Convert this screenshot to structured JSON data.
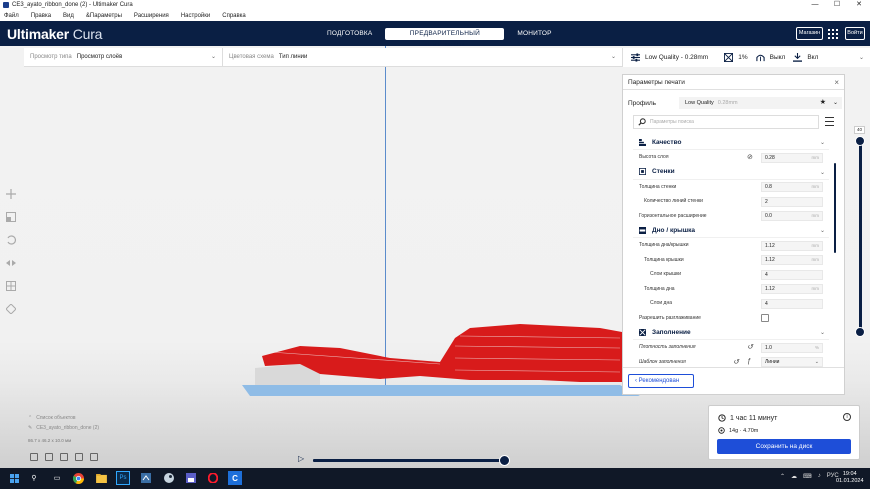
{
  "window": {
    "title": "CE3_ayato_ribbon_done (2) - Ultimaker Cura",
    "min": "—",
    "max": "☐",
    "close": "✕"
  },
  "menu": [
    "Файл",
    "Правка",
    "Вид",
    "&Параметры",
    "Расширения",
    "Настройки",
    "Справка"
  ],
  "header": {
    "logo_bold": "Ultimaker",
    "logo_light": " Cura",
    "stages": [
      "ПОДГОТОВКА",
      "ПРЕДВАРИТЕЛЬНЫЙ ПРОСМОТР",
      "МОНИТОР"
    ],
    "active_stage": 1,
    "marketplace": "Магазин",
    "login": "Войти"
  },
  "viewbar": {
    "view_type_label": "Просмотр типа",
    "view_type_value": "Просмотр слоёв",
    "color_scheme_label": "Цветовая схема",
    "color_scheme_value": "Тип линии"
  },
  "print_summary": {
    "profile": "Low Quality - 0.28mm",
    "infill": "1%",
    "support": "Выкл",
    "adhesion": "Вкл"
  },
  "panel": {
    "title": "Параметры печати",
    "profile_label": "Профиль",
    "profile_value": "Low Quality",
    "profile_dim": "0.28mm",
    "search_placeholder": "Параметры поиска",
    "recommended": "Рекомендован"
  },
  "settings": {
    "quality": {
      "title": "Качество",
      "layer_height": {
        "label": "Высота слоя",
        "value": "0.28",
        "unit": "mm"
      }
    },
    "walls": {
      "title": "Стенки",
      "wall_thickness": {
        "label": "Толщина стенки",
        "value": "0.8",
        "unit": "mm"
      },
      "wall_line_count": {
        "label": "Количество линий стенки",
        "value": "2"
      },
      "horizontal_expansion": {
        "label": "Горизонтальное расширение",
        "value": "0.0",
        "unit": "mm"
      }
    },
    "topbottom": {
      "title": "Дно / крышка",
      "tb_thickness": {
        "label": "Толщина дна/крышки",
        "value": "1.12",
        "unit": "mm"
      },
      "top_thickness": {
        "label": "Толщина крышки",
        "value": "1.12",
        "unit": "mm"
      },
      "top_layers": {
        "label": "Слои крышки",
        "value": "4"
      },
      "bottom_thickness": {
        "label": "Толщина дна",
        "value": "1.12",
        "unit": "mm"
      },
      "bottom_layers": {
        "label": "Слои дна",
        "value": "4"
      },
      "ironing": {
        "label": "Разрешить разглаживание",
        "checked": false
      }
    },
    "infill": {
      "title": "Заполнение",
      "density": {
        "label": "Плотность заполнения",
        "value": "1.0",
        "unit": "%"
      },
      "pattern": {
        "label": "Шаблон заполнения",
        "value": "Линии"
      }
    }
  },
  "layer_slider": {
    "top_layer": "40"
  },
  "objects": {
    "header": "Список объектов",
    "item": "CE3_ayato_ribbon_done (2)",
    "dimensions": "86.7 x 46.2 x 10.0 мм"
  },
  "print_info": {
    "time": "1 час 11 минут",
    "material": "14g · 4.70m",
    "save": "Сохранить на диск"
  },
  "taskbar": {
    "lang": "РУС",
    "time": "19:04",
    "date": "01.01.2024"
  },
  "colors": {
    "header_bg": "#0a1f44",
    "accent_blue": "#1e4ed8",
    "model_red": "#d81b1b",
    "skirt_blue": "#6fa8dc"
  },
  "icons": [
    "search-icon",
    "settings-menu-icon",
    "link-icon",
    "reset-icon",
    "function-icon",
    "clock-icon",
    "spool-icon",
    "info-icon",
    "play-icon",
    "close-icon"
  ]
}
